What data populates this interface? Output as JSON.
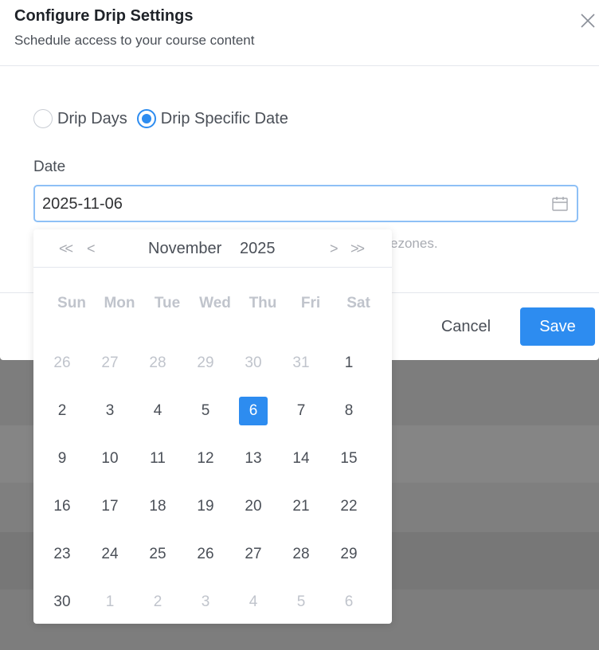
{
  "dialog": {
    "title": "Configure Drip Settings",
    "subtitle": "Schedule access to your course content",
    "close_icon": "close-icon"
  },
  "drip_mode": {
    "options": [
      {
        "label": "Drip Days",
        "checked": false
      },
      {
        "label": "Drip Specific Date",
        "checked": true
      }
    ]
  },
  "date_field": {
    "label": "Date",
    "value": "2025-11-06",
    "icon": "calendar-icon"
  },
  "helper_text": "ezones.",
  "footer": {
    "cancel_label": "Cancel",
    "save_label": "Save"
  },
  "datepicker": {
    "prev_year_label": "<<",
    "prev_month_label": "<",
    "next_month_label": ">",
    "next_year_label": ">>",
    "month": "November",
    "year": "2025",
    "weekdays": [
      "Sun",
      "Mon",
      "Tue",
      "Wed",
      "Thu",
      "Fri",
      "Sat"
    ],
    "weeks": [
      [
        {
          "d": "26",
          "m": true
        },
        {
          "d": "27",
          "m": true
        },
        {
          "d": "28",
          "m": true
        },
        {
          "d": "29",
          "m": true
        },
        {
          "d": "30",
          "m": true
        },
        {
          "d": "31",
          "m": true
        },
        {
          "d": "1",
          "m": false
        }
      ],
      [
        {
          "d": "2",
          "m": false
        },
        {
          "d": "3",
          "m": false
        },
        {
          "d": "4",
          "m": false
        },
        {
          "d": "5",
          "m": false
        },
        {
          "d": "6",
          "m": false,
          "s": true
        },
        {
          "d": "7",
          "m": false
        },
        {
          "d": "8",
          "m": false
        }
      ],
      [
        {
          "d": "9",
          "m": false
        },
        {
          "d": "10",
          "m": false
        },
        {
          "d": "11",
          "m": false
        },
        {
          "d": "12",
          "m": false
        },
        {
          "d": "13",
          "m": false
        },
        {
          "d": "14",
          "m": false
        },
        {
          "d": "15",
          "m": false
        }
      ],
      [
        {
          "d": "16",
          "m": false
        },
        {
          "d": "17",
          "m": false
        },
        {
          "d": "18",
          "m": false
        },
        {
          "d": "19",
          "m": false
        },
        {
          "d": "20",
          "m": false
        },
        {
          "d": "21",
          "m": false
        },
        {
          "d": "22",
          "m": false
        }
      ],
      [
        {
          "d": "23",
          "m": false
        },
        {
          "d": "24",
          "m": false
        },
        {
          "d": "25",
          "m": false
        },
        {
          "d": "26",
          "m": false
        },
        {
          "d": "27",
          "m": false
        },
        {
          "d": "28",
          "m": false
        },
        {
          "d": "29",
          "m": false
        }
      ],
      [
        {
          "d": "30",
          "m": false
        },
        {
          "d": "1",
          "m": true
        },
        {
          "d": "2",
          "m": true
        },
        {
          "d": "3",
          "m": true
        },
        {
          "d": "4",
          "m": true
        },
        {
          "d": "5",
          "m": true
        },
        {
          "d": "6",
          "m": true
        }
      ]
    ]
  },
  "colors": {
    "accent": "#2d8cf0",
    "overlay": "#808080"
  }
}
